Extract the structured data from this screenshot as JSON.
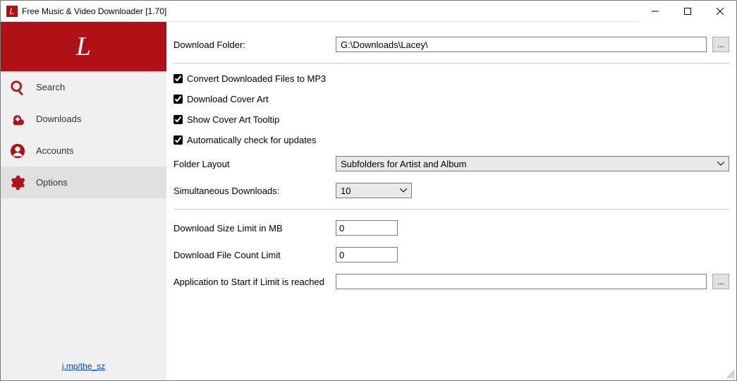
{
  "title": "Free Music & Video Downloader [1.70]",
  "brand_letter": "L",
  "sidebar": {
    "items": [
      {
        "label": "Search"
      },
      {
        "label": "Downloads"
      },
      {
        "label": "Accounts"
      },
      {
        "label": "Options"
      }
    ]
  },
  "footer_link": "j.mp/the_sz",
  "options": {
    "download_folder_label": "Download Folder:",
    "download_folder_value": "G:\\Downloads\\Lacey\\",
    "convert_mp3_label": "Convert Downloaded Files to MP3",
    "cover_art_label": "Download Cover Art",
    "tooltip_label": "Show Cover Art Tooltip",
    "updates_label": "Automatically check for updates",
    "folder_layout_label": "Folder Layout",
    "folder_layout_value": "Subfolders for Artist and Album",
    "simultaneous_label": "Simultaneous Downloads:",
    "simultaneous_value": "10",
    "size_limit_label": "Download Size Limit in MB",
    "size_limit_value": "0",
    "count_limit_label": "Download File Count Limit",
    "count_limit_value": "0",
    "app_limit_label": "Application to Start if Limit is reached",
    "app_limit_value": "",
    "browse_label": "..."
  }
}
